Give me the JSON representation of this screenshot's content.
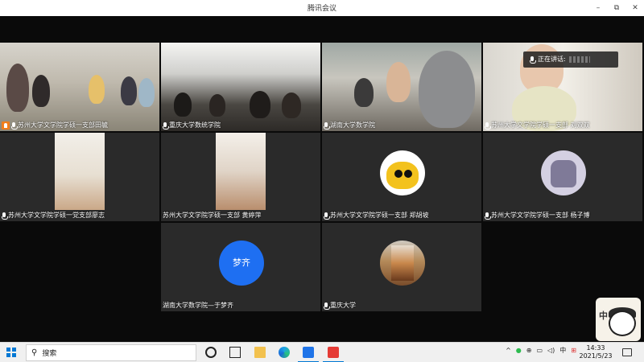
{
  "window": {
    "title": "腾讯会议",
    "controls": {
      "minimize": "–",
      "maximize": "⧉",
      "close": "✕"
    }
  },
  "speaking_indicator": {
    "label": "正在讲话:"
  },
  "participants": [
    {
      "name": "苏州大学文学院学硕一支部田毓",
      "video": true,
      "host": true
    },
    {
      "name": "重庆大学数统学院",
      "video": true
    },
    {
      "name": "湖南大学数学院",
      "video": true
    },
    {
      "name": "苏州大学文学院学硕一支部 刘双双",
      "video": true
    },
    {
      "name": "苏州大学文学院学硕一党支部廖志",
      "video": true
    },
    {
      "name": "苏州大学文学院学硕一支部 黄婷萍",
      "video": true
    },
    {
      "name": "苏州大学文学院学硕一支部 郑胡坡",
      "avatar": "yellow-robot-avatar"
    },
    {
      "name": "苏州大学文学院学硕一支部 杨子博",
      "avatar": "lilac-animal-avatar"
    },
    {
      "name": "湖南大学数学院—于梦齐",
      "avatar_text": "梦齐"
    },
    {
      "name": "重庆大学",
      "avatar": "book-cover-avatar"
    }
  ],
  "sticker": {
    "char": "中"
  },
  "taskbar": {
    "search_placeholder": "搜索",
    "tray_icons": [
      "^",
      "●",
      "⊕",
      "▭",
      "◁)",
      "中",
      "⊞"
    ],
    "time": "14:33",
    "date": "2021/5/23"
  },
  "colors": {
    "accent": "#0078d4",
    "host_badge": "#f07d1b",
    "avatar_blue": "#1e6ff2"
  }
}
